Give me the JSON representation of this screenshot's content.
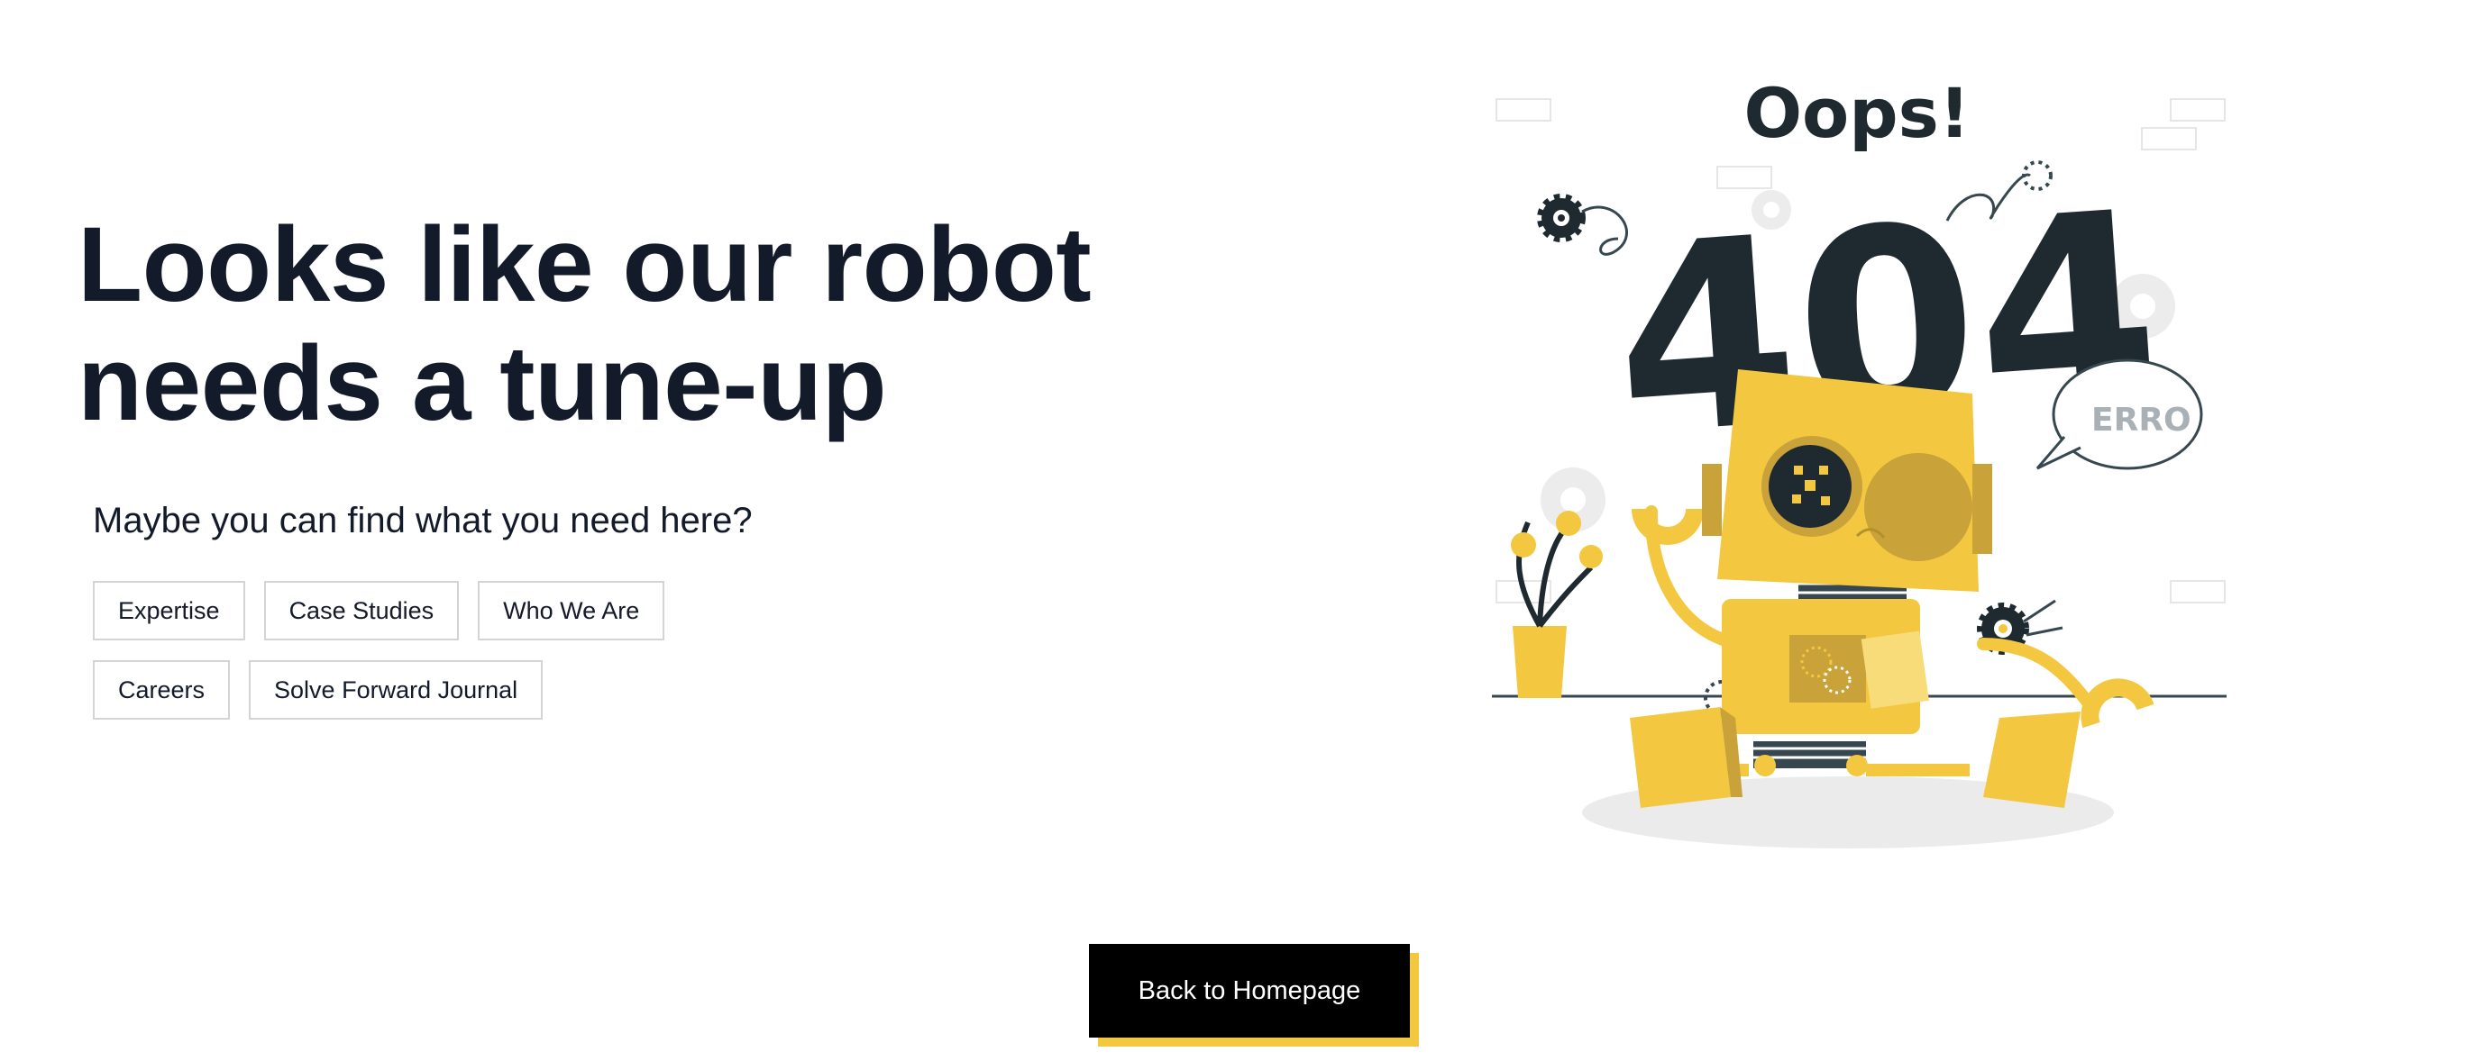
{
  "headline": {
    "line1": "Looks like our robot",
    "line2": "needs a tune-up"
  },
  "subtitle": "Maybe you can find what you need here?",
  "links": [
    {
      "label": "Expertise"
    },
    {
      "label": "Case Studies"
    },
    {
      "label": "Who We Are"
    },
    {
      "label": "Careers"
    },
    {
      "label": "Solve Forward Journal"
    }
  ],
  "illustration": {
    "oops_text": "Oops!",
    "code_text": "404",
    "bubble_text": "ERRO"
  },
  "cta": {
    "label": "Back to Homepage"
  },
  "colors": {
    "text": "#131a2a",
    "accent_yellow": "#f3c740",
    "button_bg": "#000000",
    "illustration_dark": "#1f2a30"
  }
}
